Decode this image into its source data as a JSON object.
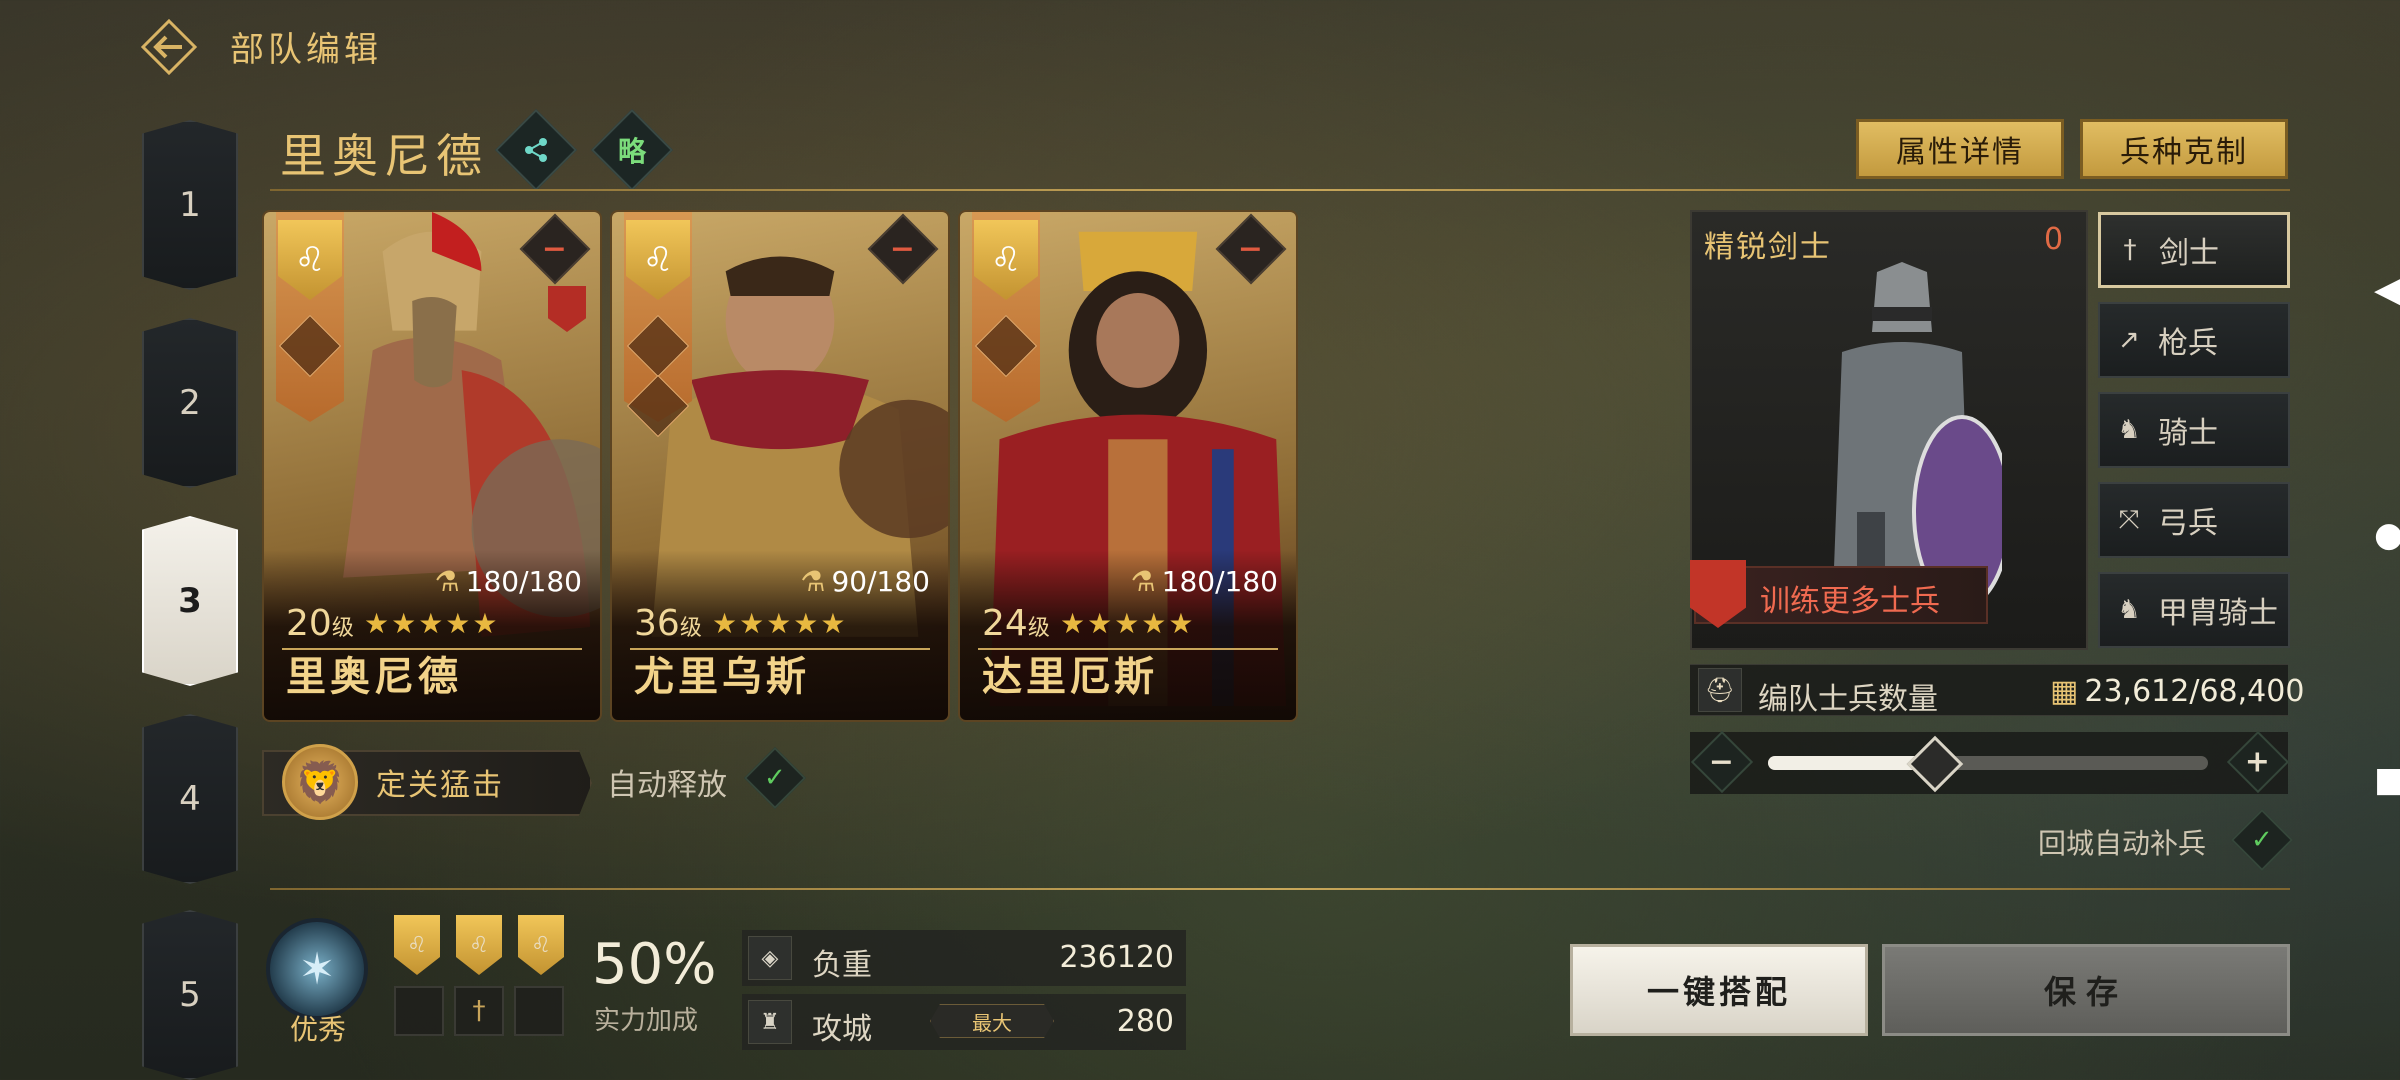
{
  "header": {
    "title": "部队编辑"
  },
  "tabs": [
    "1",
    "2",
    "3",
    "4",
    "5"
  ],
  "active_tab": "3",
  "team": {
    "name": "里奥尼德",
    "strategy_label": "略",
    "buttons": {
      "attributes": "属性详情",
      "counters": "兵种克制"
    }
  },
  "heroes": [
    {
      "level": "20",
      "level_suffix": "级",
      "stars": "★★★★★",
      "troops": "180/180",
      "name": "里奥尼德"
    },
    {
      "level": "36",
      "level_suffix": "级",
      "stars": "★★★★★",
      "troops": "90/180",
      "name": "尤里乌斯"
    },
    {
      "level": "24",
      "level_suffix": "级",
      "stars": "★★★★★",
      "troops": "180/180",
      "name": "达里厄斯"
    }
  ],
  "skill": {
    "name": "定关猛击",
    "auto_label": "自动释放",
    "auto_enabled": true
  },
  "soldier": {
    "title": "精锐剑士",
    "count": "0",
    "train_label": "训练更多士兵",
    "unit_types": [
      "剑士",
      "枪兵",
      "骑士",
      "弓兵",
      "甲胄骑士"
    ],
    "active_unit": "剑士"
  },
  "formation": {
    "label": "编队士兵数量",
    "value": "23,612/68,400",
    "fill_fraction": 0.38
  },
  "auto_refill": {
    "label": "回城自动补兵",
    "enabled": true
  },
  "rank": {
    "label": "优秀"
  },
  "power": {
    "percent": "50%",
    "label": "实力加成"
  },
  "stats": {
    "load_label": "负重",
    "load_value": "236120",
    "siege_label": "攻城",
    "siege_badge": "最大",
    "siege_value": "280"
  },
  "actions": {
    "auto_match": "一键搭配",
    "save": "保存"
  },
  "colors": {
    "gold": "#e8c474",
    "accent_red": "#e06a45",
    "check_green": "#5fcc5f"
  }
}
